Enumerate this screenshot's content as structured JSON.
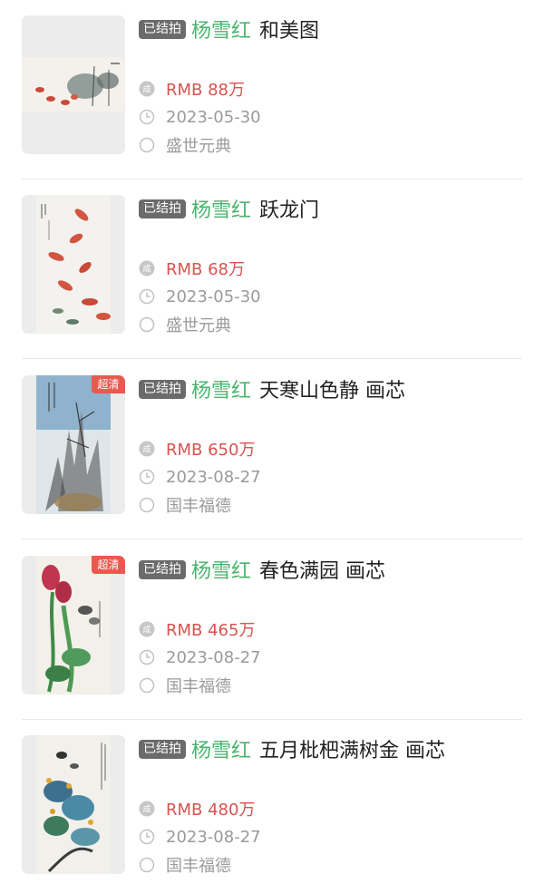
{
  "colors": {
    "artist": "#4cb36e",
    "price": "#d9534f",
    "status_badge": "#6b6b6b",
    "hd_badge": "#e85a4f",
    "muted": "#9a9a9a"
  },
  "icons": {
    "price": "deal-icon",
    "date": "clock-icon",
    "auction": "circle-icon"
  },
  "items": [
    {
      "status": "已结拍",
      "artist": "杨雪红",
      "title": "和美图",
      "price_prefix": "RMB ",
      "price_value": "88",
      "price_unit": "万",
      "date": "2023-05-30",
      "auction_house": "盛世元典",
      "hd_badge": ""
    },
    {
      "status": "已结拍",
      "artist": "杨雪红",
      "title": "跃龙门",
      "price_prefix": "RMB ",
      "price_value": "68",
      "price_unit": "万",
      "date": "2023-05-30",
      "auction_house": "盛世元典",
      "hd_badge": ""
    },
    {
      "status": "已结拍",
      "artist": "杨雪红",
      "title": "天寒山色静 画芯",
      "price_prefix": "RMB ",
      "price_value": "650",
      "price_unit": "万",
      "date": "2023-08-27",
      "auction_house": "国丰福德",
      "hd_badge": "超清"
    },
    {
      "status": "已结拍",
      "artist": "杨雪红",
      "title": "春色满园 画芯",
      "price_prefix": "RMB ",
      "price_value": "465",
      "price_unit": "万",
      "date": "2023-08-27",
      "auction_house": "国丰福德",
      "hd_badge": "超清"
    },
    {
      "status": "已结拍",
      "artist": "杨雪红",
      "title": "五月枇杷满树金 画芯",
      "price_prefix": "RMB ",
      "price_value": "480",
      "price_unit": "万",
      "date": "2023-08-27",
      "auction_house": "国丰福德",
      "hd_badge": ""
    }
  ]
}
